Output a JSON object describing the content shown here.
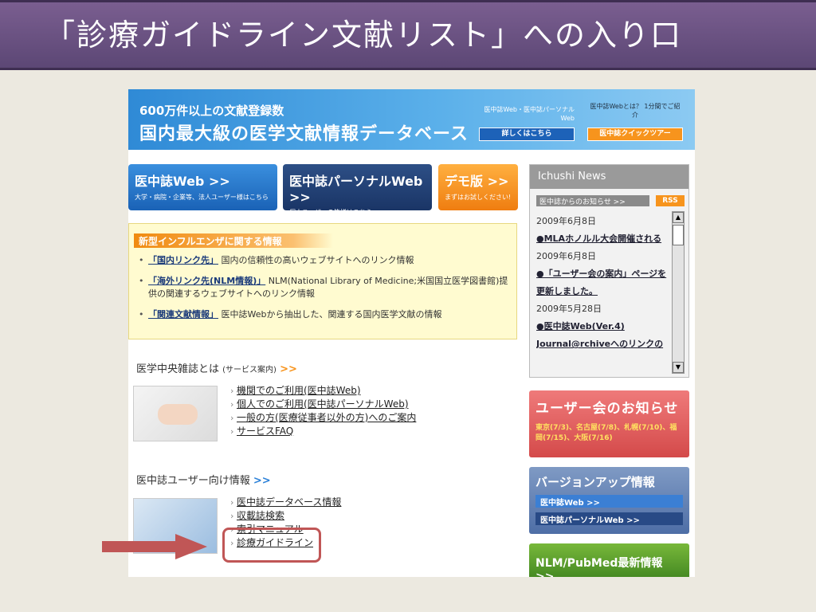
{
  "slide": {
    "title": "「診療ガイドライン文献リスト」への入り口"
  },
  "banner": {
    "line1": "600万件以上の文献登録数",
    "line2": "国内最大級の医学文献情報データベース",
    "side1_text": "医中誌Web・医中誌パーソナルWeb",
    "side1_button": "詳しくはこちら",
    "side2_text": "医中誌Webとは？ 1分間でご紹介",
    "side2_button": "医中誌クイックツアー"
  },
  "nav": [
    {
      "title": "医中誌Web >>",
      "desc": "大学・病院・企業等、法人ユーザー様はこちら"
    },
    {
      "title": "医中誌パーソナルWeb >>",
      "desc": "個人ユーザーの皆様はこちら"
    },
    {
      "title": "デモ版 >>",
      "desc": "まずはお試しください!"
    }
  ],
  "news": {
    "header": "Ichushi News",
    "sub": "医中誌からのお知らせ >>",
    "rss": "RSS",
    "items": [
      {
        "date": "2009年6月8日",
        "text": "●MLAホノルル大会開催される"
      },
      {
        "date": "2009年6月8日",
        "text": "●「ユーザー会の案内」ページを更新しました。"
      },
      {
        "date": "2009年5月28日",
        "text": "●医中誌Web(Ver.4) Journal@rchiveへのリンクの"
      }
    ]
  },
  "flu": {
    "title": "新型インフルエンザに関する情報",
    "items": [
      {
        "link": "「国内リンク先」",
        "text": "国内の信頼性の高いウェブサイトへのリンク情報"
      },
      {
        "link": "「海外リンク先(NLM情報)」",
        "text": "NLM(National Library of Medicine;米国国立医学図書館)提供の関連するウェブサイトへのリンク情報"
      },
      {
        "link": "「関連文献情報」",
        "text": "医中誌Webから抽出した、関連する国内医学文献の情報"
      }
    ]
  },
  "service": {
    "title": "医学中央雑誌とは",
    "sub": "(サービス案内)",
    "arrow": ">>",
    "links": [
      "機関でのご利用(医中誌Web)",
      "個人でのご利用(医中誌パーソナルWeb)",
      "一般の方(医療従事者以外の方)へのご案内",
      "サービスFAQ"
    ]
  },
  "user_info": {
    "title": "医中誌ユーザー向け情報",
    "arrow": ">>",
    "links": [
      "医中誌データベース情報",
      "収載誌検索",
      "索引マニュアル",
      "診療ガイドライン"
    ]
  },
  "right_boxes": {
    "usermeet_title": "ユーザー会のお知らせ",
    "usermeet_detail": "東京(7/3)、名古屋(7/8)、札幌(7/10)、福岡(7/15)、大阪(7/16)",
    "version_title": "バージョンアップ情報",
    "version_btn1": "医中誌Web >>",
    "version_btn2": "医中誌パーソナルWeb >>",
    "nlm_title": "NLM/PubMed最新情報 >>"
  },
  "colors": {
    "slide_title_bg": "#6b5283",
    "highlight": "#c05656",
    "accent_orange": "#f7941d",
    "accent_blue": "#2a80d8"
  }
}
